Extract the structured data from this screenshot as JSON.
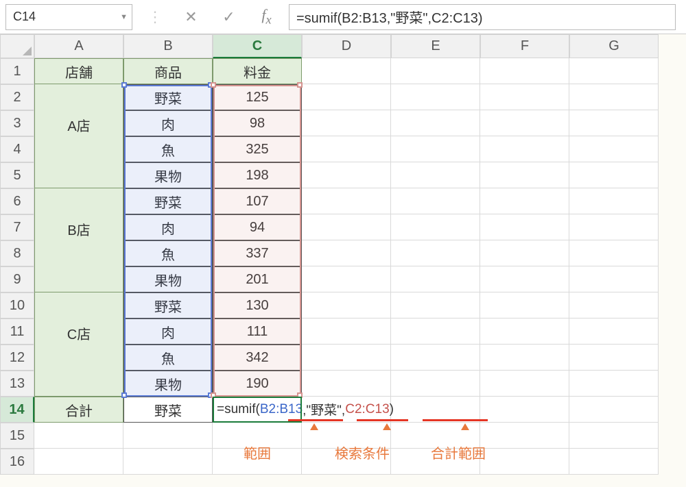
{
  "namebox": {
    "ref": "C14"
  },
  "formula_bar": {
    "value": "=sumif(B2:B13,\"野菜\",C2:C13)"
  },
  "columns": [
    "A",
    "B",
    "C",
    "D",
    "E",
    "F",
    "G"
  ],
  "rows_shown": 16,
  "active_col": "C",
  "active_row": 14,
  "headers": {
    "a1": "店舗",
    "b1": "商品",
    "c1": "料金"
  },
  "stores": [
    "A店",
    "B店",
    "C店"
  ],
  "products": [
    "野菜",
    "肉",
    "魚",
    "果物",
    "野菜",
    "肉",
    "魚",
    "果物",
    "野菜",
    "肉",
    "魚",
    "果物"
  ],
  "prices": [
    "125",
    "98",
    "325",
    "198",
    "107",
    "94",
    "337",
    "201",
    "130",
    "111",
    "342",
    "190"
  ],
  "summary": {
    "label": "合計",
    "criteria": "野菜"
  },
  "cell_formula": {
    "prefix": "=sumif(",
    "arg1": "B2:B13",
    "sep1": ",\"",
    "criteria": "野菜",
    "sep2": "\",",
    "arg3": "C2:C13",
    "suffix": ")"
  },
  "annotations": {
    "range": "範囲",
    "criteria": "検索条件",
    "sum_range": "合計範囲"
  }
}
